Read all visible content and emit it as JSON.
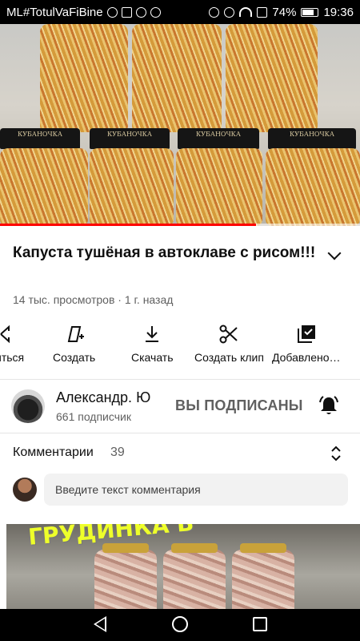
{
  "status_bar": {
    "carrier": "ML#TotulVaFiBine",
    "battery": "74%",
    "time": "19:36"
  },
  "video": {
    "jar_label": "КУБАНОЧКА",
    "progress": 0.71,
    "accent_color": "#ff0000"
  },
  "title": "Капуста тушёная в автоклаве с рисом!!!",
  "meta": "14 тыс. просмотров · 1 г. назад",
  "actions": [
    {
      "label": "иться",
      "icon": "share-icon"
    },
    {
      "label": "Создать",
      "icon": "remix-icon"
    },
    {
      "label": "Скачать",
      "icon": "download-icon"
    },
    {
      "label": "Создать клип",
      "icon": "scissors-icon"
    },
    {
      "label": "Добавлено…",
      "icon": "playlist-added-icon"
    }
  ],
  "channel": {
    "name": "Александр. Ю",
    "subscribers": "661 подписчик",
    "subscribe_state": "ВЫ ПОДПИСАНЫ"
  },
  "comments": {
    "title": "Комментарии",
    "count": "39",
    "placeholder": "Введите текст комментария"
  },
  "next_video": {
    "overlay_text": "ГРУДИНКА В ",
    "accent_color": "#eeff2a"
  }
}
